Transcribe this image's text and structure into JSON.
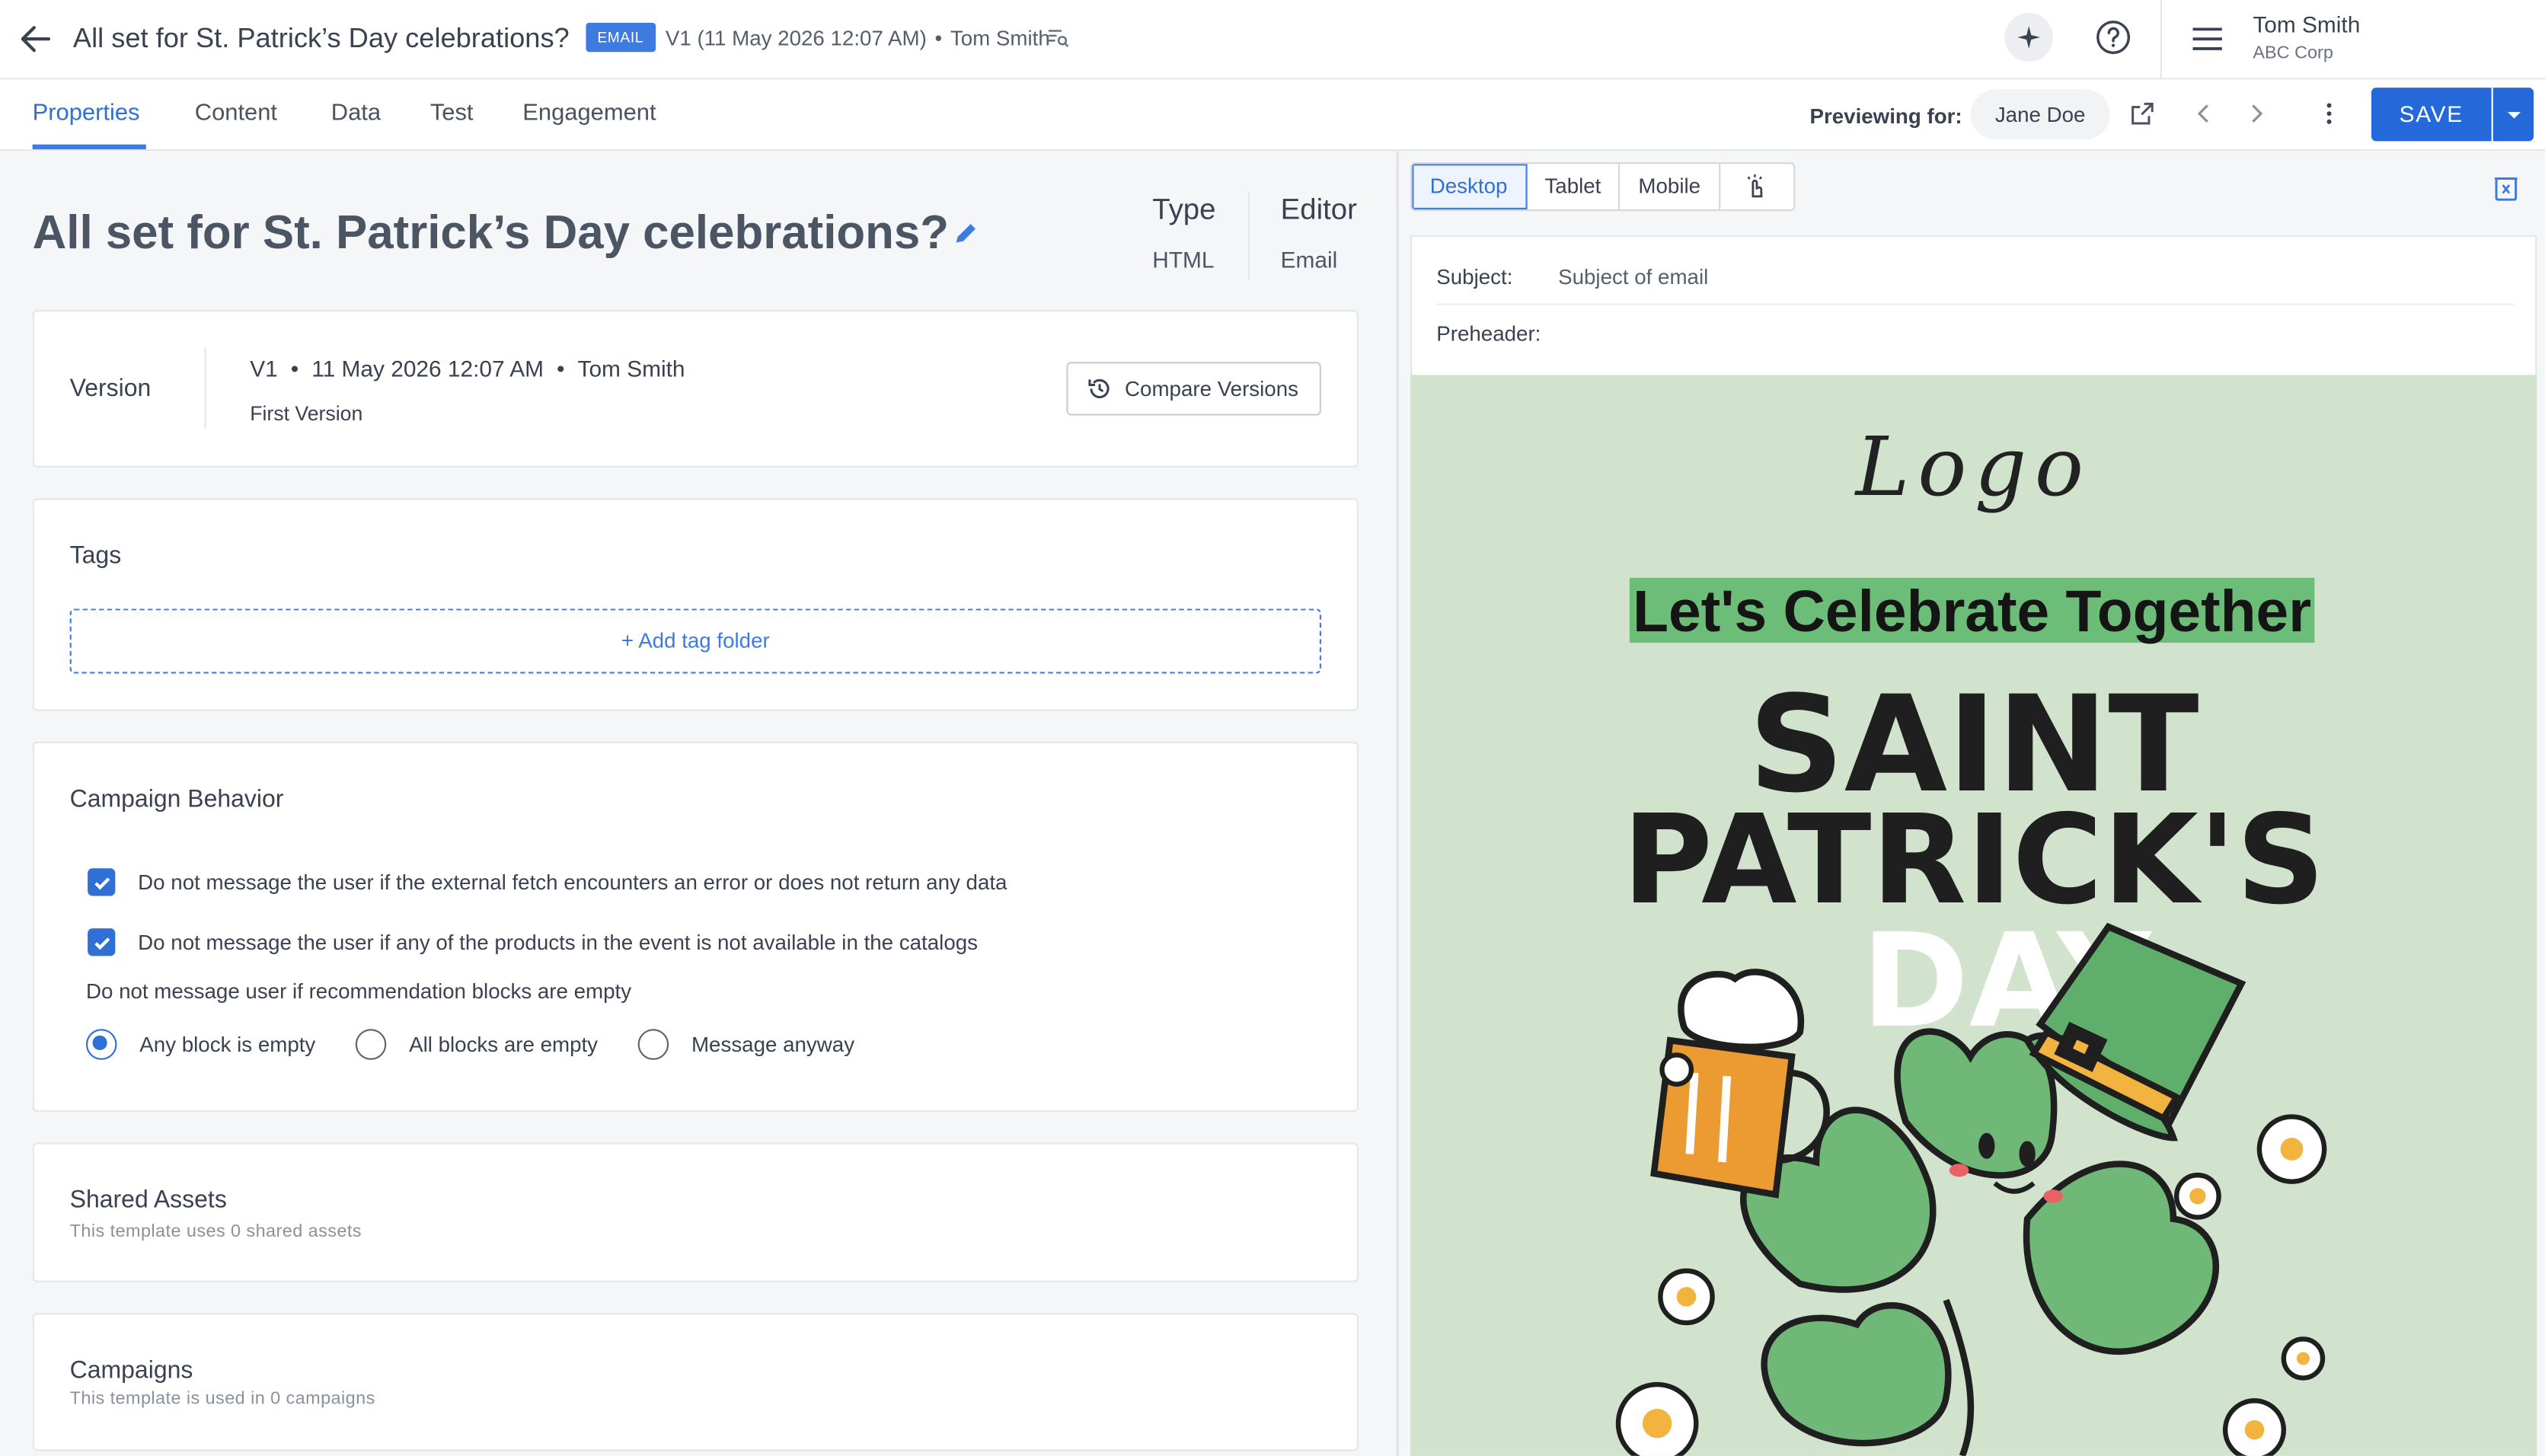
{
  "topbar": {
    "title": "All set for St. Patrick’s Day celebrations?",
    "badge": "EMAIL",
    "version": "V1 (11 May 2026 12:07 AM)",
    "author": "Tom Smith",
    "user_name": "Tom Smith",
    "user_org": "ABC Corp"
  },
  "tabs": [
    {
      "label": "Properties",
      "active": true
    },
    {
      "label": "Content"
    },
    {
      "label": "Data"
    },
    {
      "label": "Test"
    },
    {
      "label": "Engagement"
    }
  ],
  "preview": {
    "label": "Previewing for:",
    "user": "Jane Doe",
    "save": "SAVE"
  },
  "properties": {
    "title": "All set for St. Patrick’s Day celebrations?",
    "type_label": "Type",
    "type_value": "HTML",
    "editor_label": "Editor",
    "editor_value": "Email"
  },
  "version_card": {
    "title": "Version",
    "version": "V1",
    "date": "11 May 2026 12:07 AM",
    "author": "Tom Smith",
    "note": "First Version",
    "compare_label": "Compare Versions"
  },
  "tags_card": {
    "title": "Tags",
    "add_label": "+ Add tag folder"
  },
  "campaign_card": {
    "title": "Campaign Behavior",
    "checks": [
      {
        "label": "Do not message the user if the external fetch encounters an error or does not return any data",
        "checked": true
      },
      {
        "label": "Do not message the user if any of the products in the event is not available in the catalogs",
        "checked": true
      }
    ],
    "rec_label": "Do not message user if recommendation blocks are empty",
    "radios": [
      {
        "label": "Any block is empty",
        "selected": true
      },
      {
        "label": "All blocks are empty",
        "selected": false
      },
      {
        "label": "Message anyway",
        "selected": false
      }
    ]
  },
  "shared_card": {
    "title": "Shared Assets",
    "subtitle": "This template uses 0 shared assets"
  },
  "campaigns_card": {
    "title": "Campaigns",
    "subtitle": "This template is used in 0 campaigns"
  },
  "devices": [
    {
      "label": "Desktop",
      "active": true
    },
    {
      "label": "Tablet"
    },
    {
      "label": "Mobile"
    }
  ],
  "email_header": {
    "subject_label": "Subject:",
    "subject_value": "Subject of email",
    "preheader_label": "Preheader:"
  },
  "email_body": {
    "logo": "Logo",
    "headline": "Let's Celebrate Together",
    "word1": "SAINT",
    "word2": "PATRICK'S",
    "word3": "DAY"
  },
  "colors": {
    "accent": "#2468d9",
    "canvas_bg": "#d1e3cc",
    "headline_highlight": "#6cbd78",
    "shamrock": "#6fb877",
    "hat": "#5fae6c"
  }
}
